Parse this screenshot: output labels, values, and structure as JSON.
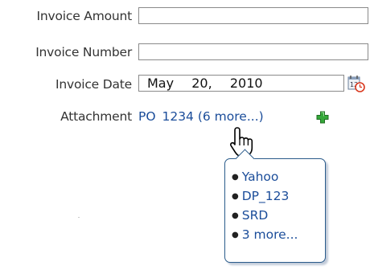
{
  "form": {
    "invoice_amount": {
      "label": "Invoice Amount",
      "value": ""
    },
    "invoice_number": {
      "label": "Invoice Number",
      "value": ""
    },
    "invoice_date": {
      "label": "Invoice Date",
      "value": "May  20,  2010",
      "icon": "calendar-clock-icon"
    },
    "attachment": {
      "label": "Attachment",
      "link_primary": "PO  1234",
      "link_more": " (6 more...)",
      "add_icon": "green-plus-icon"
    }
  },
  "popup": {
    "items": [
      "Yahoo",
      "DP_123",
      "SRD",
      "3 more..."
    ]
  },
  "cursor": "hand-pointer-icon",
  "colors": {
    "link": "#1b4d9a",
    "popup_border": "#2a5b8b",
    "plus": "#2fa12f"
  }
}
